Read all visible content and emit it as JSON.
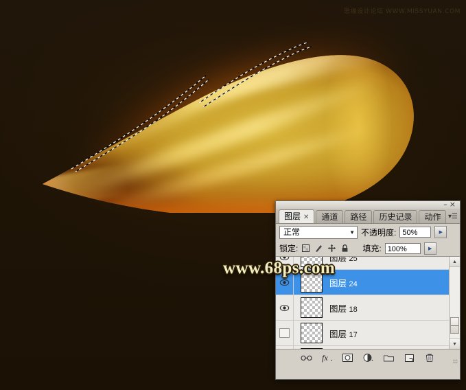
{
  "artwork": {
    "title": "golden glowing leaf artwork",
    "background_color": "#1e1406",
    "leaf_colors": [
      "#d8b53a",
      "#c9a12c",
      "#b8841d",
      "#8c5410",
      "#e6700c"
    ],
    "selection": "marching-ants selection path along upper-left leaf edge"
  },
  "watermarks": {
    "top_right": "思缘设计论坛 WWW.MISSYUAN.COM",
    "center": "www.68ps.com"
  },
  "panel": {
    "window_buttons": {
      "minimize": "–",
      "close": "×"
    },
    "menu_icon": "panel-menu",
    "tabs": [
      {
        "label": "图层",
        "active": true,
        "closable": true
      },
      {
        "label": "通道",
        "active": false,
        "closable": false
      },
      {
        "label": "路径",
        "active": false,
        "closable": false
      },
      {
        "label": "历史记录",
        "active": false,
        "closable": false
      },
      {
        "label": "动作",
        "active": false,
        "closable": false
      }
    ],
    "blend_row": {
      "mode": "正常",
      "opacity_label": "不透明度:",
      "opacity_value": "50%"
    },
    "lock_row": {
      "lock_label": "锁定:",
      "lock_icons": [
        "lock-transparent-pixels",
        "lock-image-pixels",
        "lock-position",
        "lock-all"
      ],
      "fill_label": "填充:",
      "fill_value": "100%"
    },
    "layers": [
      {
        "name": "图层",
        "number": "25",
        "visible": true,
        "selected": false
      },
      {
        "name": "图层",
        "number": "24",
        "visible": true,
        "selected": true
      },
      {
        "name": "图层",
        "number": "18",
        "visible": true,
        "selected": false
      },
      {
        "name": "图层",
        "number": "17",
        "visible": false,
        "selected": false
      }
    ],
    "scrollbar": {
      "up": "▲",
      "down": "▼"
    },
    "toolbar_buttons": [
      "link-layers-icon",
      "add-layer-style-fx-icon",
      "add-layer-mask-icon",
      "new-adjustment-layer-icon",
      "new-group-icon",
      "new-layer-icon",
      "delete-layer-icon"
    ]
  }
}
